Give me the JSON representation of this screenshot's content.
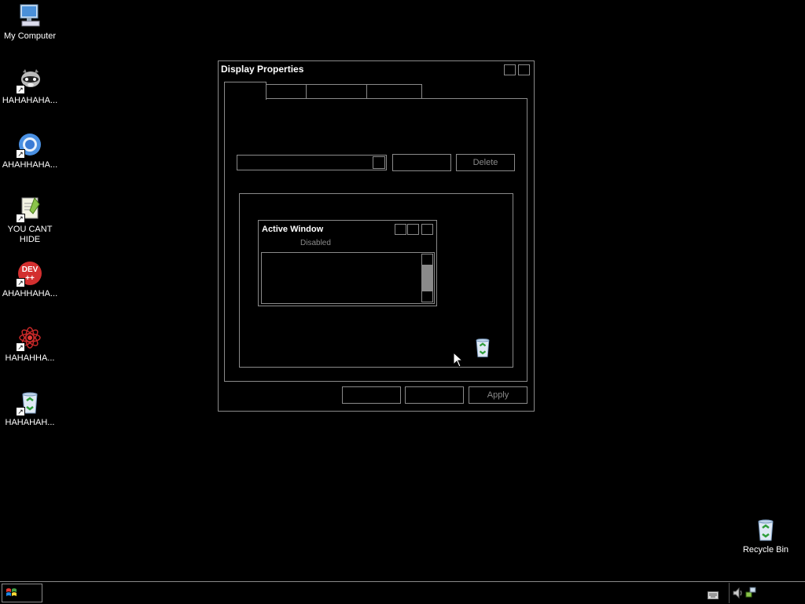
{
  "desktop": {
    "icons": [
      {
        "label": "My Computer",
        "icon": "my-computer-icon"
      },
      {
        "label": "HAHAHAHA...",
        "icon": "raccoon-shortcut-icon"
      },
      {
        "label": "AHAHHAHA...",
        "icon": "chrome-shortcut-icon"
      },
      {
        "label": "YOU CANT HIDE",
        "icon": "notepad-plus-plus-shortcut-icon"
      },
      {
        "label": "AHAHHAHA...",
        "icon": "dev-cpp-shortcut-icon"
      },
      {
        "label": "HAHAHHA...",
        "icon": "red-flower-shortcut-icon"
      },
      {
        "label": "HAHAHAH...",
        "icon": "recycle-bin-shortcut-icon"
      }
    ],
    "recycle_bin": {
      "label": "Recycle Bin",
      "icon": "recycle-bin-icon"
    }
  },
  "dialog": {
    "title": "Display Properties",
    "tabs": [
      "",
      "",
      "",
      ""
    ],
    "delete_label": "Delete",
    "apply_label": "Apply",
    "preview": {
      "active_window_title": "Active Window",
      "disabled_text": "Disabled"
    }
  },
  "colors": {
    "background": "#000000",
    "border": "#8a8a8a",
    "text": "#ffffff",
    "disabled": "#8a8a8a"
  }
}
